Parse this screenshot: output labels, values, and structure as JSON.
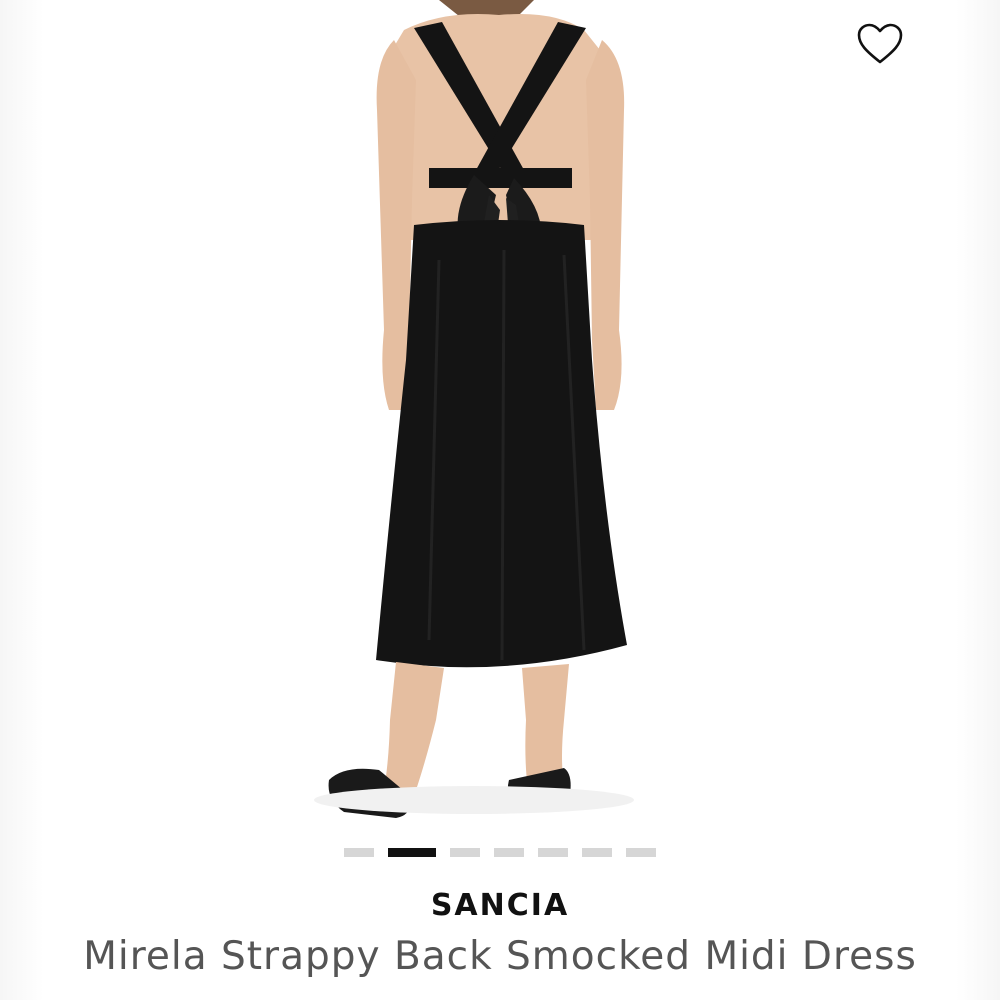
{
  "listing": {
    "brand": "SANCIA",
    "title": "Mirela Strappy Back Smocked Midi Dress"
  },
  "image": {
    "subject": "woman-back-view-black-strappy-midi-dress",
    "dress_color": "#141414",
    "skin_color": "#e8c3a6",
    "background_color": "#ffffff"
  },
  "carousel": {
    "count": 7,
    "active_index": 1
  },
  "icons": {
    "favorite": "heart-outline-icon"
  },
  "colors": {
    "text_primary": "#111111",
    "text_secondary": "#555555",
    "dot_inactive": "#d6d6d6",
    "dot_active": "#111111"
  }
}
